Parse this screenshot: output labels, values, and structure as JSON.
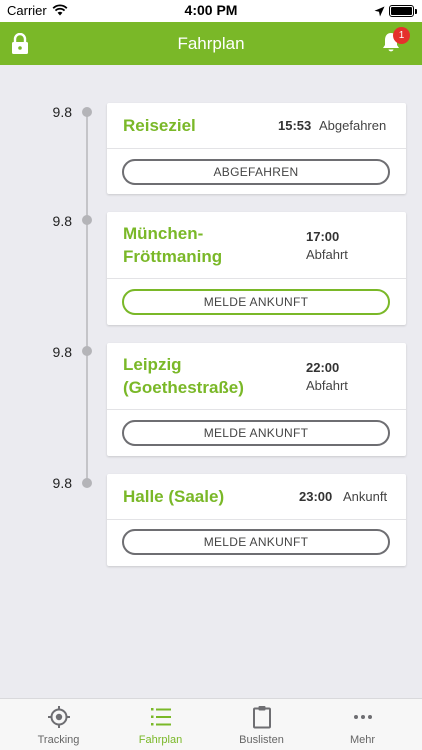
{
  "status_bar": {
    "carrier": "Carrier",
    "time": "4:00 PM"
  },
  "nav": {
    "title": "Fahrplan",
    "notification_count": "1"
  },
  "timeline": [
    {
      "day": "9.8",
      "destination_lines": [
        "Reiseziel"
      ],
      "time": "15:53",
      "status": "Abgefahren",
      "button": "ABGEFAHREN",
      "highlight": false
    },
    {
      "day": "9.8",
      "destination_lines": [
        "München-",
        "Fröttmaning"
      ],
      "time": "17:00",
      "status": "Abfahrt",
      "button": "MELDE ANKUNFT",
      "highlight": true
    },
    {
      "day": "9.8",
      "destination_lines": [
        "Leipzig",
        "(Goethestraße)"
      ],
      "time": "22:00",
      "status": "Abfahrt",
      "button": "MELDE ANKUNFT",
      "highlight": false
    },
    {
      "day": "9.8",
      "destination_lines": [
        "Halle (Saale)"
      ],
      "time": "23:00",
      "status": "Ankunft",
      "button": "MELDE ANKUNFT",
      "highlight": false
    }
  ],
  "tabs": [
    {
      "label": "Tracking",
      "icon": "target-icon",
      "active": false
    },
    {
      "label": "Fahrplan",
      "icon": "list-icon",
      "active": true
    },
    {
      "label": "Buslisten",
      "icon": "clipboard-icon",
      "active": false
    },
    {
      "label": "Mehr",
      "icon": "more-icon",
      "active": false
    }
  ],
  "colors": {
    "accent": "#7ab828",
    "badge": "#e5312c",
    "background": "#ebebf0"
  }
}
